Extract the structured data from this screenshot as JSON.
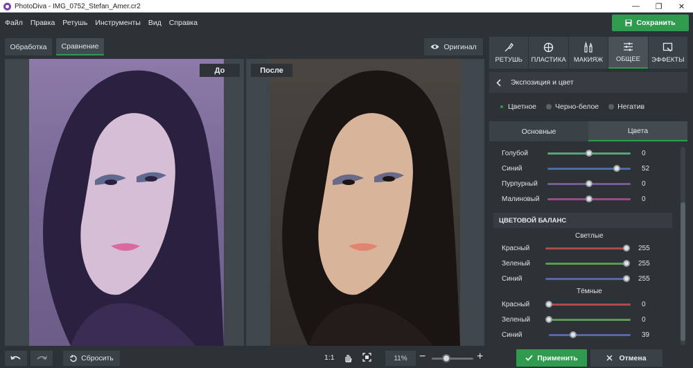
{
  "window": {
    "title": "PhotoDiva - IMG_0752_Stefan_Amer.cr2",
    "controls": [
      "—",
      "❐",
      "✕"
    ]
  },
  "menu": [
    "Файл",
    "Правка",
    "Ретушь",
    "Инструменты",
    "Вид",
    "Справка"
  ],
  "save_label": "Сохранить",
  "view_tabs": {
    "processing": "Обработка",
    "compare": "Сравнение"
  },
  "original_label": "Оригинал",
  "panels": {
    "before": "До",
    "after": "После"
  },
  "right_tabs": [
    "РЕТУШЬ",
    "ПЛАСТИКА",
    "МАКИЯЖ",
    "ОБЩЕЕ",
    "ЭФФЕКТЫ"
  ],
  "section_title": "Экспозиция и цвет",
  "modes": [
    "Цветное",
    "Черно-белое",
    "Негатив"
  ],
  "sub_tabs": [
    "Основные",
    "Цвета"
  ],
  "color_sliders": [
    {
      "label": "Голубой",
      "value": "0",
      "level": 0.5,
      "color": "#58a47a"
    },
    {
      "label": "Синий",
      "value": "52",
      "level": 0.83,
      "color": "#4b6ea8"
    },
    {
      "label": "Пурпурный",
      "value": "0",
      "level": 0.5,
      "color": "#7a5aa0"
    },
    {
      "label": "Малиновый",
      "value": "0",
      "level": 0.5,
      "color": "#9c4a88"
    }
  ],
  "color_balance": {
    "title": "ЦВЕТОВОЙ БАЛАНС",
    "light_label": "Светлые",
    "dark_label": "Тёмные",
    "light": [
      {
        "label": "Красный",
        "value": "255",
        "level": 1.0,
        "color": "#b0494c"
      },
      {
        "label": "Зеленый",
        "value": "255",
        "level": 1.0,
        "color": "#5c9a55"
      },
      {
        "label": "Синий",
        "value": "255",
        "level": 1.0,
        "color": "#5b66a6"
      }
    ],
    "dark": [
      {
        "label": "Красный",
        "value": "0",
        "level": 0.0,
        "color": "#b0494c"
      },
      {
        "label": "Зеленый",
        "value": "0",
        "level": 0.0,
        "color": "#5c9a55"
      },
      {
        "label": "Синий",
        "value": "39",
        "level": 0.3,
        "color": "#5b66a6"
      }
    ]
  },
  "bottom": {
    "reset": "Сбросить",
    "ratio": "1:1",
    "zoom": "11%",
    "zoom_level": 0.35,
    "apply": "Применить",
    "cancel": "Отмена"
  },
  "colors": {
    "accent": "#2f9b4e",
    "background": "#2c3236"
  }
}
